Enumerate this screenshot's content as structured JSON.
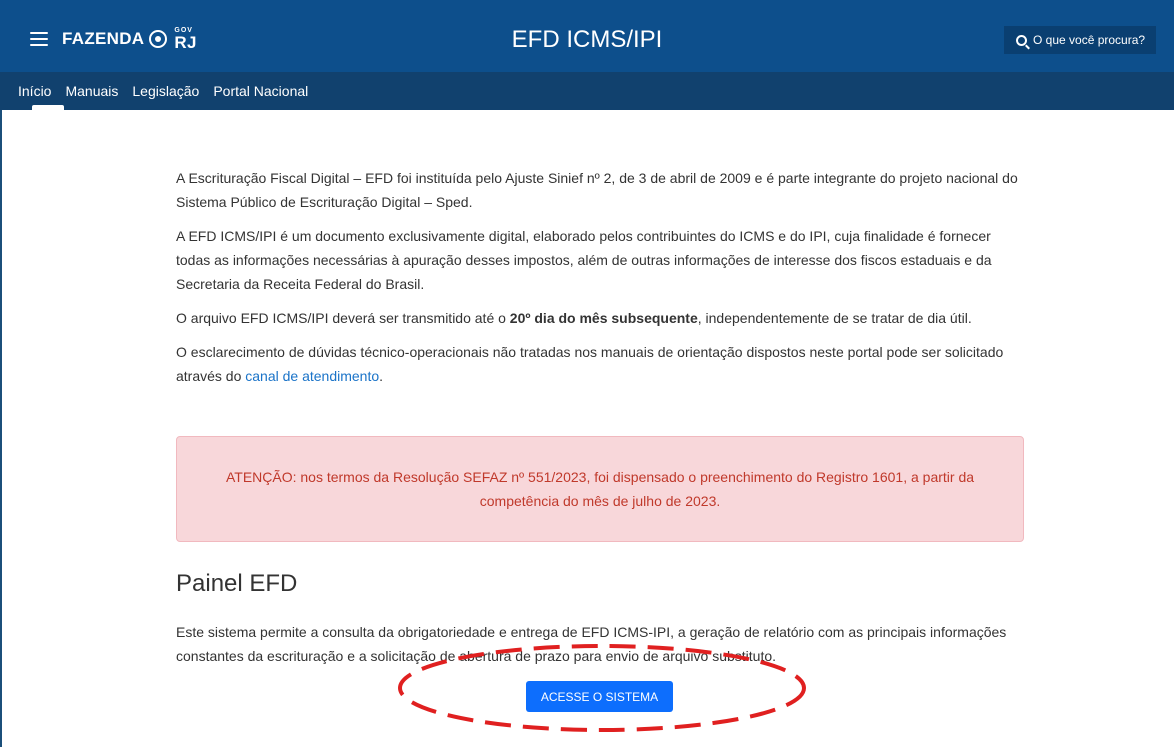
{
  "header": {
    "brand_name": "FAZENDA",
    "gov_label": "GOV",
    "rj_label": "RJ",
    "title": "EFD ICMS/IPI",
    "search_label": "O que você procura?"
  },
  "nav": {
    "items": [
      {
        "label": "Início",
        "active": true
      },
      {
        "label": "Manuais"
      },
      {
        "label": "Legislação"
      },
      {
        "label": "Portal Nacional"
      }
    ]
  },
  "main": {
    "p1": "A Escrituração Fiscal Digital – EFD foi instituída pelo Ajuste Sinief nº 2, de 3 de abril de 2009 e é parte integrante do projeto nacional do Sistema Público de Escrituração Digital – Sped.",
    "p2": "A EFD ICMS/IPI é um documento exclusivamente digital, elaborado pelos contribuintes do ICMS e do IPI, cuja finalidade é fornecer todas as informações necessárias à apuração desses impostos, além de outras informações de interesse dos fiscos estaduais e da Secretaria da Receita Federal do Brasil.",
    "p3_before": "O arquivo EFD ICMS/IPI deverá ser transmitido até o ",
    "p3_bold": "20º dia do mês subsequente",
    "p3_after": ", independentemente de se tratar de dia útil.",
    "p4_before": "O esclarecimento de dúvidas técnico-operacionais não tratadas nos manuais de orientação dispostos neste portal pode ser solicitado através do ",
    "p4_link": "canal de atendimento",
    "p4_after": ".",
    "alert": "ATENÇÃO: nos termos da Resolução SEFAZ nº 551/2023, foi dispensado o preenchimento do Registro 1601, a partir da competência do mês de julho de 2023."
  },
  "painel": {
    "title": "Painel EFD",
    "text": "Este sistema permite a consulta da obrigatoriedade e entrega de EFD ICMS-IPI, a geração de relatório com as principais informações constantes da escrituração e a solicitação de abertura de prazo para envio de arquivo substituto.",
    "button_label": "ACESSE O SISTEMA"
  },
  "colors": {
    "header_bg": "#0d4f8c",
    "nav_bg": "#11416e",
    "alert_bg": "#f8d7da",
    "alert_text": "#c0392b",
    "button_bg": "#0d6efd",
    "annotation": "#e02020"
  }
}
